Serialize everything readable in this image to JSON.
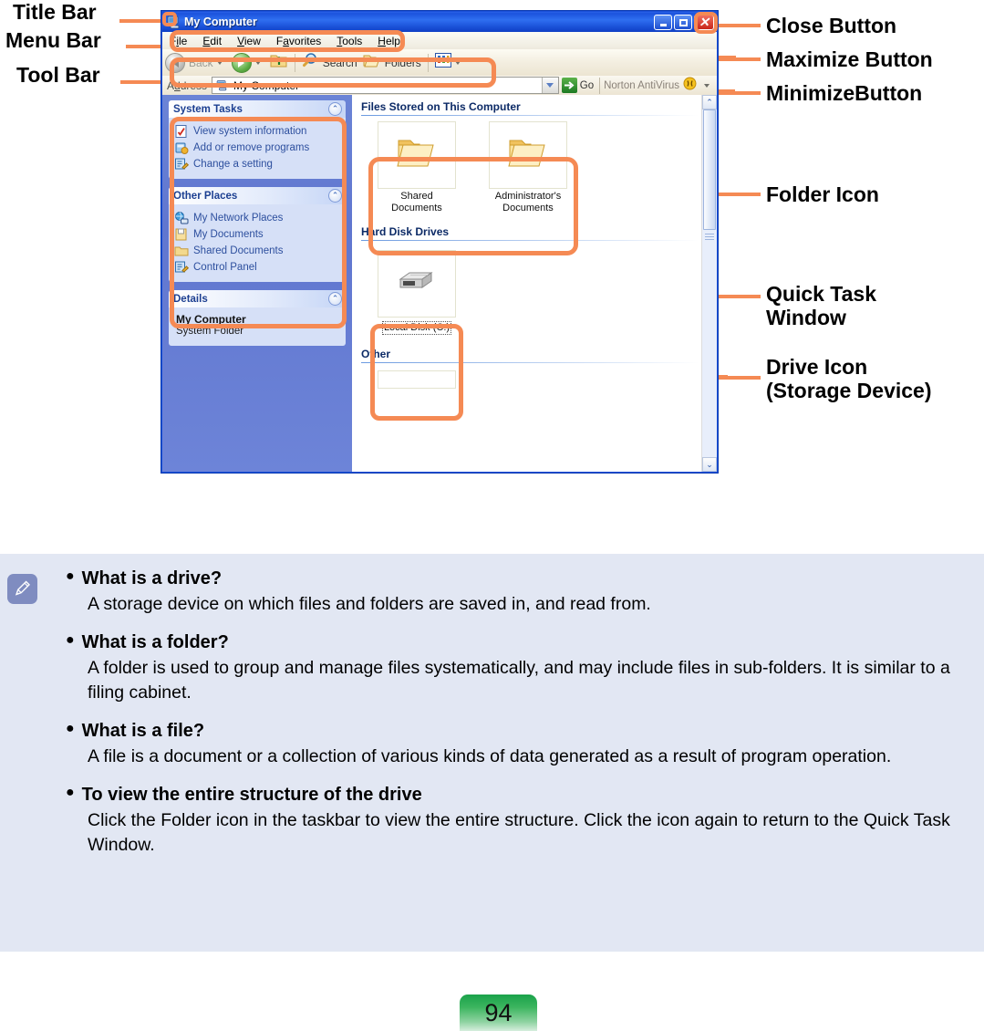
{
  "callouts": {
    "title_bar": "Title Bar",
    "menu_bar": "Menu Bar",
    "tool_bar": "Tool Bar",
    "close_button": "Close Button",
    "maximize_button": "Maximize Button",
    "minimize_button": "MinimizeButton",
    "folder_icon": "Folder Icon",
    "quick_task_window": "Quick Task\nWindow",
    "drive_icon": "Drive Icon\n(Storage Device)"
  },
  "window": {
    "title": "My Computer",
    "title_icon": "my-computer-icon",
    "buttons": {
      "minimize": "_",
      "maximize": "□",
      "close": "×"
    },
    "menus": [
      {
        "pre": "F",
        "key": "i",
        "post": "le"
      },
      {
        "pre": "",
        "key": "E",
        "post": "dit"
      },
      {
        "pre": "",
        "key": "V",
        "post": "iew"
      },
      {
        "pre": "F",
        "key": "a",
        "post": "vorites"
      },
      {
        "pre": "",
        "key": "T",
        "post": "ools"
      },
      {
        "pre": "",
        "key": "H",
        "post": "elp"
      }
    ],
    "toolbar": {
      "back": "Back",
      "search": "Search",
      "folders": "Folders",
      "up_icon": "up-folder-icon",
      "views_icon": "views-icon"
    },
    "address": {
      "label_pre": "A",
      "label_key": "d",
      "label_post": "dress",
      "value": "My Computer",
      "go": "Go",
      "norton": "Norton AntiVirus"
    },
    "sidebar": {
      "panels": [
        {
          "title": "System Tasks",
          "collapse_icon": "collapse-chevron-icon",
          "items": [
            {
              "label": "View system information",
              "icon": "system-info-icon"
            },
            {
              "label": "Add or remove programs",
              "icon": "add-remove-programs-icon"
            },
            {
              "label": "Change a setting",
              "icon": "change-setting-icon"
            }
          ]
        },
        {
          "title": "Other Places",
          "collapse_icon": "collapse-chevron-icon",
          "items": [
            {
              "label": "My Network Places",
              "icon": "network-places-icon"
            },
            {
              "label": "My Documents",
              "icon": "my-documents-icon"
            },
            {
              "label": "Shared Documents",
              "icon": "shared-documents-icon"
            },
            {
              "label": "Control Panel",
              "icon": "control-panel-icon"
            }
          ]
        }
      ],
      "details": {
        "title": "Details",
        "collapse_icon": "collapse-chevron-icon",
        "name": "My Computer",
        "type": "System Folder"
      }
    },
    "content": {
      "groups": [
        {
          "title": "Files Stored on This Computer",
          "tiles": [
            {
              "label": "Shared Documents",
              "icon": "folder-icon"
            },
            {
              "label": "Administrator's Documents",
              "icon": "folder-icon"
            }
          ]
        },
        {
          "title": "Hard Disk Drives",
          "tiles": [
            {
              "label": "Local Disk (C:)",
              "icon": "hard-drive-icon"
            }
          ]
        },
        {
          "title": "Other",
          "tiles": []
        }
      ]
    }
  },
  "note": {
    "icon": "pencil-note-icon",
    "items": [
      {
        "title": "What is a drive?",
        "body": "A storage device on which files and folders are saved in, and read from."
      },
      {
        "title": "What is a folder?",
        "body": "A folder is used to group and manage files systematically, and may include files in sub-folders. It is similar to a filing cabinet."
      },
      {
        "title": "What is a file?",
        "body": "A file is a document or a collection of various kinds of data generated as a result of program operation."
      },
      {
        "title": "To view the entire structure of the drive",
        "body": "Click the Folder icon in the taskbar to view the entire structure. Click the icon again to return to the Quick Task Window."
      }
    ]
  },
  "footer": {
    "page_number": "94"
  },
  "colors": {
    "accent_orange": "#f58a54",
    "title_blue": "#1a50d8",
    "note_bg": "#e2e7f3",
    "page_green": "#1aa24a"
  }
}
